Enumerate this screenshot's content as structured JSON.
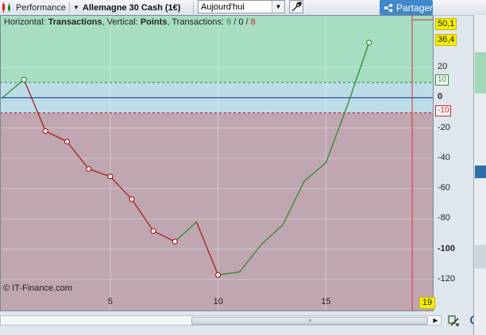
{
  "toolbar": {
    "performance_label": "Performance",
    "instrument_label": "Allemagne 30 Cash (1€)",
    "period_value": "Aujourd'hui",
    "share_label": "Partager"
  },
  "chart_info": {
    "horizontal_key": "Horizontal:",
    "horizontal_value": "Transactions",
    "vertical_key": ", Vertical:",
    "vertical_value": "Points",
    "transactions_key": ", Transactions:",
    "count_green": "9",
    "count_sep1": " / ",
    "count_black": "0",
    "count_sep2": " / ",
    "count_red": "8",
    "watermark": "© IT-Finance.com"
  },
  "badges": {
    "max_value": "50,1",
    "last_value": "36,4",
    "x_last": "19",
    "upper_band": "10",
    "lower_band": "-10"
  },
  "y_ticks": [
    {
      "label": "20",
      "value": 20,
      "bold": false
    },
    {
      "label": "0",
      "value": 0,
      "bold": true
    },
    {
      "label": "-20",
      "value": -20,
      "bold": false
    },
    {
      "label": "-40",
      "value": -40,
      "bold": false
    },
    {
      "label": "-60",
      "value": -60,
      "bold": false
    },
    {
      "label": "-80",
      "value": -80,
      "bold": false
    },
    {
      "label": "-100",
      "value": -100,
      "bold": true
    },
    {
      "label": "-120",
      "value": -120,
      "bold": false
    }
  ],
  "x_ticks": [
    {
      "label": "5",
      "value": 5
    },
    {
      "label": "10",
      "value": 10
    },
    {
      "label": "15",
      "value": 15
    }
  ],
  "colors": {
    "profit_zone": "#a6ddc3",
    "neutral_zone": "#bcdce8",
    "loss_zone": "#bfa6b0",
    "win_line": "#2e8b2e",
    "loss_line": "#aa1e1e",
    "zero_line": "#1b3f8f",
    "cursor_line": "#e03030",
    "share_button": "#3f88c9"
  },
  "chart_data": {
    "type": "line",
    "xlabel": "Transactions",
    "ylabel": "Points",
    "xlim": [
      0,
      19
    ],
    "ylim": [
      -130,
      52
    ],
    "bands": {
      "upper": 10,
      "lower": -10
    },
    "points": [
      {
        "x": 0,
        "y": 0,
        "marker": false
      },
      {
        "x": 1,
        "y": 12,
        "marker": true
      },
      {
        "x": 2,
        "y": -22,
        "marker": true
      },
      {
        "x": 3,
        "y": -29,
        "marker": true
      },
      {
        "x": 4,
        "y": -47,
        "marker": true
      },
      {
        "x": 5,
        "y": -52,
        "marker": true
      },
      {
        "x": 6,
        "y": -67,
        "marker": true
      },
      {
        "x": 7,
        "y": -88,
        "marker": true
      },
      {
        "x": 8,
        "y": -95,
        "marker": true
      },
      {
        "x": 9,
        "y": -82,
        "marker": false
      },
      {
        "x": 10,
        "y": -117,
        "marker": true
      },
      {
        "x": 11,
        "y": -115,
        "marker": false
      },
      {
        "x": 12,
        "y": -97,
        "marker": false
      },
      {
        "x": 13,
        "y": -84,
        "marker": false
      },
      {
        "x": 14,
        "y": -55,
        "marker": false
      },
      {
        "x": 15,
        "y": -43,
        "marker": false
      },
      {
        "x": 16,
        "y": -5,
        "marker": false
      },
      {
        "x": 17,
        "y": 36.4,
        "marker": true
      }
    ],
    "cursor_x": 19
  }
}
